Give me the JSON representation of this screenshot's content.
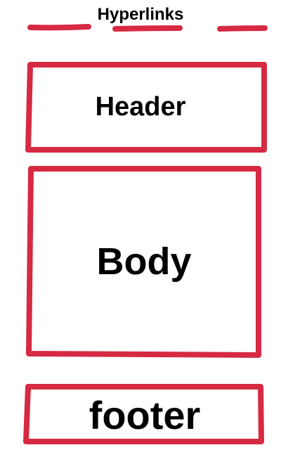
{
  "nav": {
    "title": "Hyperlinks",
    "links": [
      {
        "icon": "dash-link-placeholder"
      },
      {
        "icon": "dash-link-placeholder"
      },
      {
        "icon": "dash-link-placeholder"
      }
    ]
  },
  "header": {
    "label": "Header"
  },
  "body": {
    "label": "Body"
  },
  "footer": {
    "label": "footer"
  },
  "colors": {
    "stroke": "#d62a43",
    "text": "#000000",
    "background": "#ffffff"
  }
}
